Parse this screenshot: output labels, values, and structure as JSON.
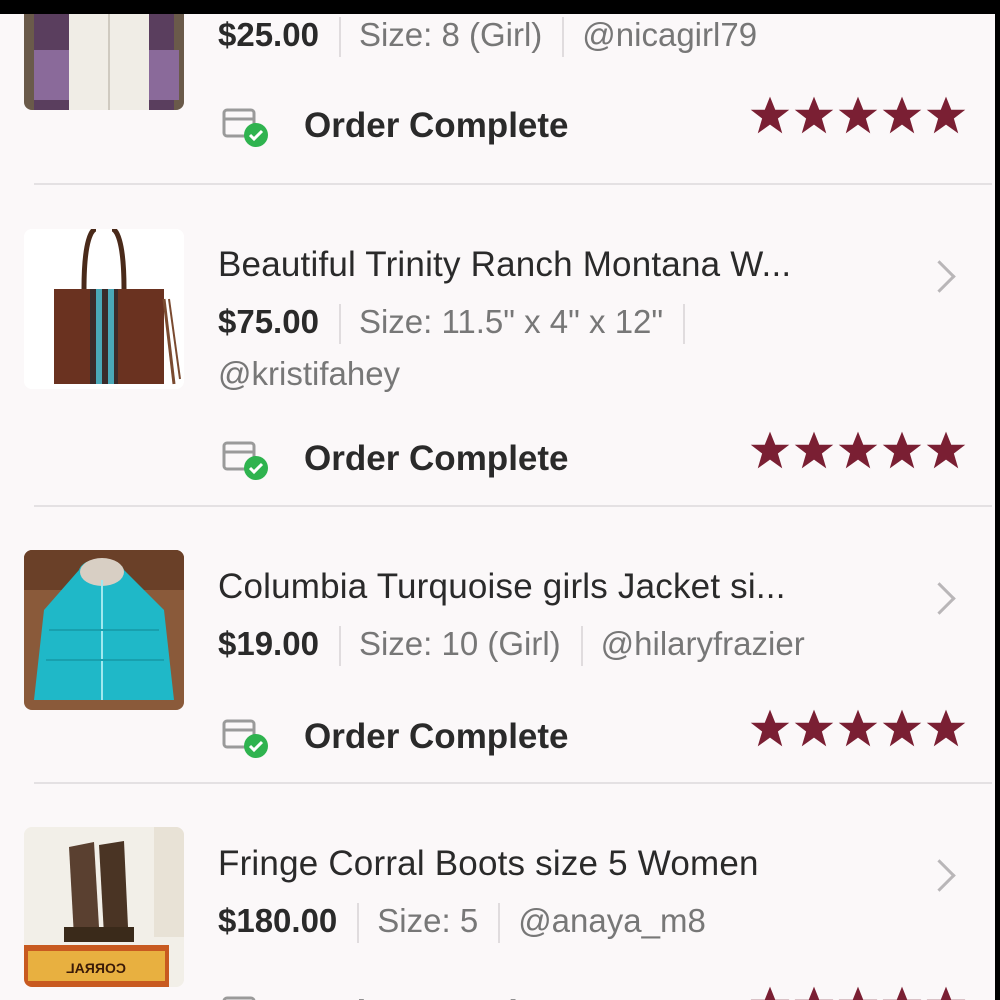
{
  "status_label": "Order Complete",
  "colors": {
    "star": "#7a1f33",
    "check": "#2fb34f",
    "divider": "#e4e1e3"
  },
  "rating": 5,
  "orders": [
    {
      "title": "",
      "price": "$25.00",
      "size": "Size: 8 (Girl)",
      "seller": "@nicagirl79"
    },
    {
      "title": "Beautiful Trinity Ranch Montana W...",
      "price": "$75.00",
      "size": "Size: 11.5\" x 4\" x 12\"",
      "seller": "@kristifahey"
    },
    {
      "title": "Columbia Turquoise girls Jacket si...",
      "price": "$19.00",
      "size": "Size: 10 (Girl)",
      "seller": "@hilaryfrazier"
    },
    {
      "title": "Fringe Corral Boots size 5 Women",
      "price": "$180.00",
      "size": "Size: 5",
      "seller": "@anaya_m8"
    }
  ],
  "thumb_text": {
    "boots_box": "CORRAL"
  }
}
